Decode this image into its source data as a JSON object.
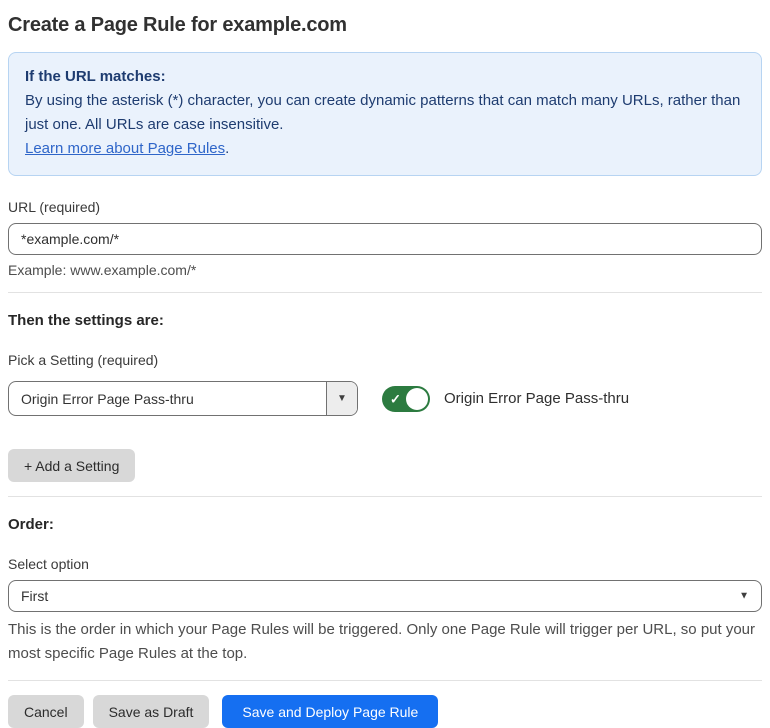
{
  "page": {
    "title": "Create a Page Rule for example.com"
  },
  "info_box": {
    "heading": "If the URL matches:",
    "body": "By using the asterisk (*) character, you can create dynamic patterns that can match many URLs, rather than just one. All URLs are case insensitive.",
    "link_label": "Learn more about Page Rules",
    "link_suffix": "."
  },
  "url_field": {
    "label": "URL (required)",
    "value": "*example.com/*",
    "helper": "Example: www.example.com/*"
  },
  "settings_section": {
    "heading": "Then the settings are:",
    "picker_label": "Pick a Setting (required)",
    "picker_value": "Origin Error Page Pass-thru",
    "toggle_state": "on",
    "toggle_label": "Origin Error Page Pass-thru",
    "add_setting_label": "+ Add a Setting"
  },
  "order_section": {
    "heading": "Order:",
    "select_label": "Select option",
    "select_value": "First",
    "helper": "This is the order in which your Page Rules will be triggered. Only one Page Rule will trigger per URL, so put your most specific Page Rules at the top."
  },
  "footer": {
    "cancel_label": "Cancel",
    "save_draft_label": "Save as Draft",
    "save_deploy_label": "Save and Deploy Page Rule"
  },
  "icons": {
    "dropdown_arrow": "▼",
    "toggle_check": "✓"
  },
  "colors": {
    "info_bg": "#eaf2fc",
    "info_border": "#b7d4f2",
    "info_text": "#1e3c70",
    "link": "#2f66c9",
    "toggle_on": "#2c7b40",
    "primary_button": "#156ff1",
    "secondary_button": "#d8d8d8"
  }
}
